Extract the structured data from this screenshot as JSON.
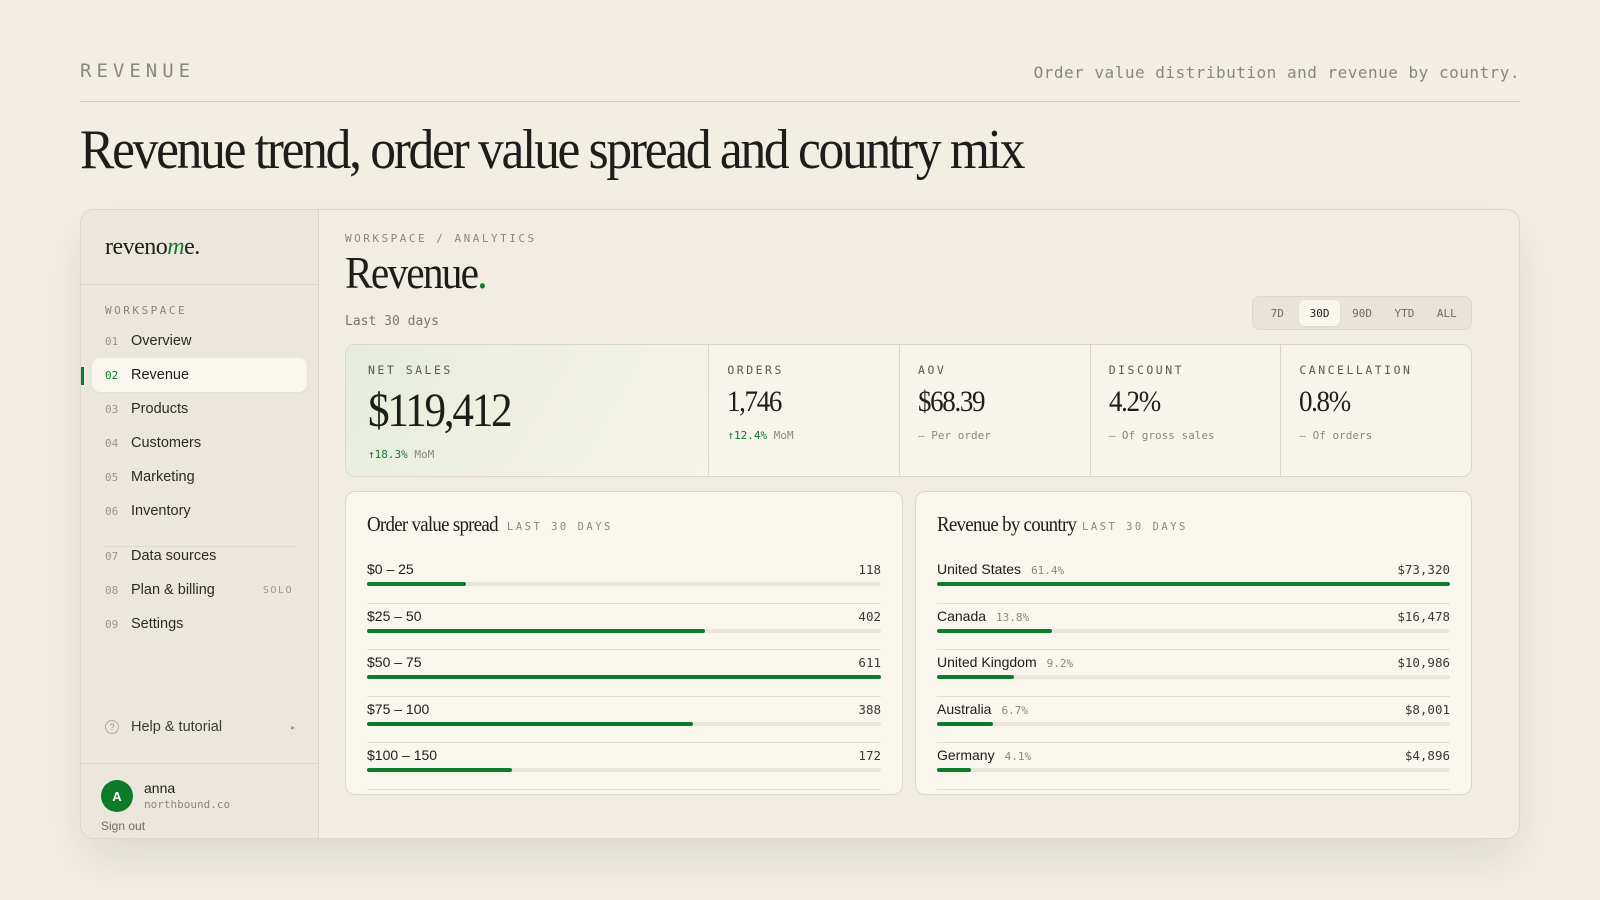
{
  "page": {
    "kicker": "REVENUE",
    "subtitle": "Order value distribution and revenue by country.",
    "headline": "Revenue trend, order value spread and country mix"
  },
  "sidebar": {
    "logo": {
      "pre": "reveno",
      "accent": "m",
      "post": "e."
    },
    "section": "WORKSPACE",
    "items": [
      {
        "num": "01",
        "label": "Overview"
      },
      {
        "num": "02",
        "label": "Revenue",
        "active": true
      },
      {
        "num": "03",
        "label": "Products"
      },
      {
        "num": "04",
        "label": "Customers"
      },
      {
        "num": "05",
        "label": "Marketing"
      },
      {
        "num": "06",
        "label": "Inventory"
      },
      {
        "num": "07",
        "label": "Data sources"
      },
      {
        "num": "08",
        "label": "Plan & billing",
        "tag": "SOLO"
      },
      {
        "num": "09",
        "label": "Settings"
      }
    ],
    "help": {
      "icon": "?",
      "label": "Help & tutorial",
      "caret": "▸"
    },
    "user": {
      "initial": "A",
      "name": "anna",
      "org": "northbound.co",
      "signout": "Sign out"
    }
  },
  "main": {
    "breadcrumb": "WORKSPACE / ANALYTICS",
    "title": "Revenue",
    "title_dot": ".",
    "period": "Last 30 days",
    "ranges": [
      {
        "label": "7D"
      },
      {
        "label": "30D",
        "active": true
      },
      {
        "label": "90D"
      },
      {
        "label": "YTD"
      },
      {
        "label": "ALL"
      }
    ],
    "kpis": [
      {
        "label": "NET SALES",
        "value": "$119,412",
        "delta": "↑18.3%",
        "note": "MoM"
      },
      {
        "label": "ORDERS",
        "value": "1,746",
        "delta": "↑12.4%",
        "note": "MoM"
      },
      {
        "label": "AOV",
        "value": "$68.39",
        "note": "— Per order"
      },
      {
        "label": "DISCOUNT",
        "value": "4.2%",
        "note": "— Of gross sales"
      },
      {
        "label": "CANCELLATION",
        "value": "0.8%",
        "note": "— Of orders"
      }
    ]
  },
  "order_value": {
    "title": "Order value spread",
    "tag": "LAST 30 DAYS",
    "max": 611,
    "rows": [
      {
        "label": "$0 – 25",
        "count": 118
      },
      {
        "label": "$25 – 50",
        "count": 402
      },
      {
        "label": "$50 – 75",
        "count": 611
      },
      {
        "label": "$75 – 100",
        "count": 388
      },
      {
        "label": "$100 – 150",
        "count": 172
      }
    ]
  },
  "by_country": {
    "title": "Revenue by country",
    "tag": "LAST 30 DAYS",
    "rows": [
      {
        "label": "United States",
        "pct": "61.4%",
        "value": "$73,320",
        "fill": 1.0
      },
      {
        "label": "Canada",
        "pct": "13.8%",
        "value": "$16,478",
        "fill": 0.225
      },
      {
        "label": "United Kingdom",
        "pct": "9.2%",
        "value": "$10,986",
        "fill": 0.15
      },
      {
        "label": "Australia",
        "pct": "6.7%",
        "value": "$8,001",
        "fill": 0.109
      },
      {
        "label": "Germany",
        "pct": "4.1%",
        "value": "$4,896",
        "fill": 0.067
      }
    ]
  },
  "colors": {
    "accent": "#0e7a2c",
    "background": "#f2eee4"
  }
}
